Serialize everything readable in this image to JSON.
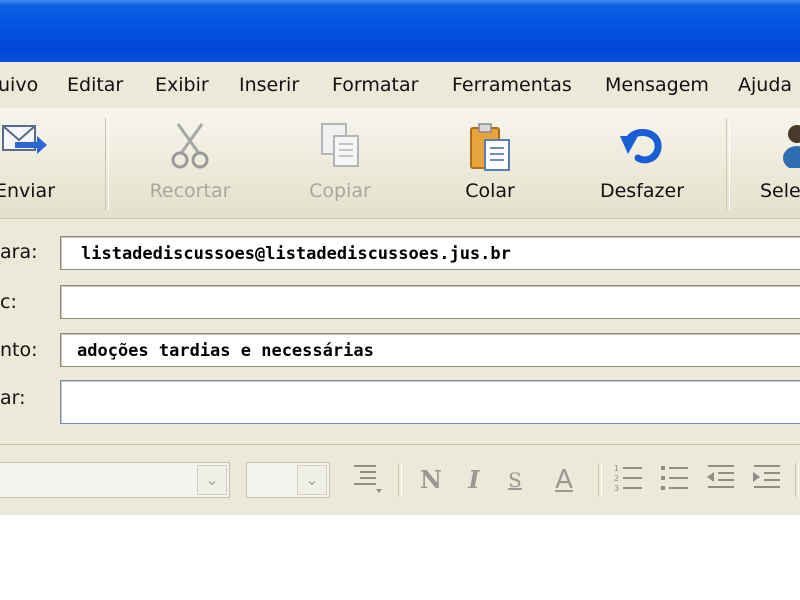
{
  "menu": {
    "items": [
      "uivo",
      "Editar",
      "Exibir",
      "Inserir",
      "Formatar",
      "Ferramentas",
      "Mensagem",
      "Ajuda"
    ]
  },
  "toolbar": {
    "send_label": "Enviar",
    "cut_label": "Recortar",
    "copy_label": "Copiar",
    "paste_label": "Colar",
    "undo_label": "Desfazer",
    "select_label": "Sele"
  },
  "header": {
    "to_label": "ara:",
    "to_value": "listadediscussoes@listadediscussoes.jus.br",
    "cc_label": "c:",
    "cc_value": "",
    "subject_label": "nto:",
    "subject_value": "adoções tardias e necessárias",
    "attach_label": "ar:",
    "attach_value": ""
  },
  "format": {
    "bold": "N",
    "italic": "I",
    "underline": "S",
    "font_color": "A"
  },
  "colors": {
    "titlebar": "#0553e0",
    "chrome": "#ece9d8",
    "undo_icon": "#1a5ed6"
  }
}
